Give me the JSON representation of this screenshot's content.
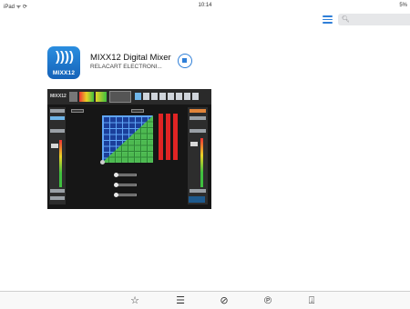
{
  "status_bar": {
    "left": "iPad ᯤ ⟳",
    "time": "10:14",
    "right": "5%"
  },
  "nav": {
    "list_icon": "list-icon",
    "search": {
      "icon": "search-icon",
      "glyph": "🔍︎",
      "placeholder": ""
    }
  },
  "app": {
    "icon_label": "MIXX12",
    "icon_glyph": "))))",
    "name": "MIXX12 Digital Mixer",
    "developer": "RELACART ELECTRONI...",
    "get_button_icon": "stop-download-icon"
  },
  "screenshot": {
    "logo_text": "MIXX12"
  },
  "tabbar": {
    "tabs": [
      {
        "name": "featured",
        "icon": "star-icon",
        "glyph": "☆"
      },
      {
        "name": "top-charts",
        "icon": "list-icon",
        "glyph": "☰"
      },
      {
        "name": "explore",
        "icon": "compass-icon",
        "glyph": "⊘"
      },
      {
        "name": "purchased",
        "icon": "purchased-icon",
        "glyph": "℗"
      },
      {
        "name": "updates",
        "icon": "download-icon",
        "glyph": "⍗"
      }
    ]
  },
  "colors": {
    "accent": "#2f7fd8",
    "app_icon": "#1d78d0",
    "eq_grid": "#1b3f9a",
    "eq_fill": "#52c44a",
    "meter": "#e02424"
  }
}
